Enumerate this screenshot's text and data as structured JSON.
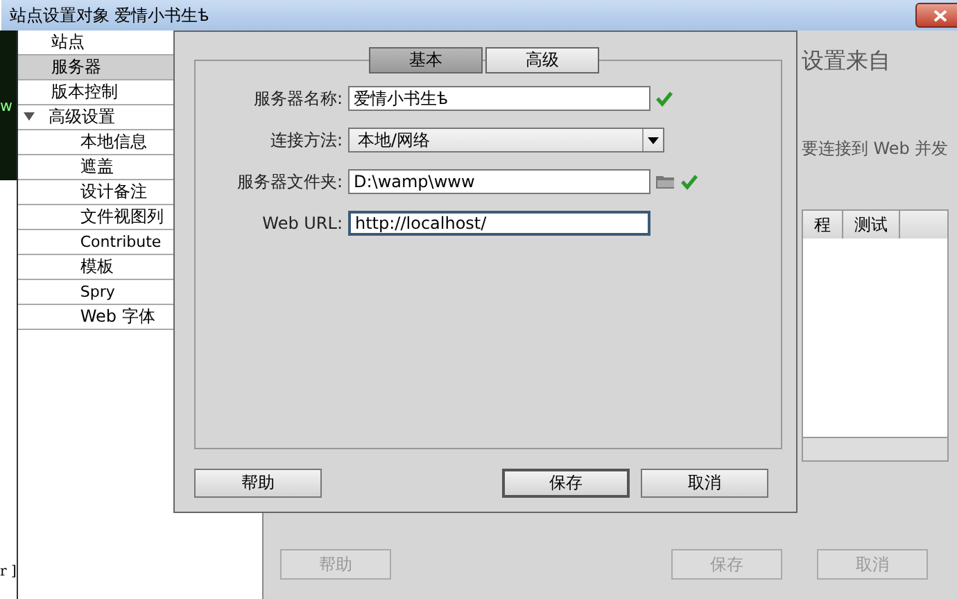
{
  "window": {
    "title": "站点设置对象 爱情小书生ѣ"
  },
  "background_app": {
    "top_text": "w",
    "bottom_text": "r ]"
  },
  "sidebar": {
    "items": [
      {
        "label": "站点",
        "selected": false
      },
      {
        "label": "服务器",
        "selected": true
      },
      {
        "label": "版本控制",
        "selected": false
      },
      {
        "label": "高级设置",
        "selected": false,
        "expanded": true,
        "children": [
          {
            "label": "本地信息",
            "selected": false
          },
          {
            "label": "遮盖",
            "selected": false
          },
          {
            "label": "设计备注",
            "selected": false
          },
          {
            "label": "文件视图列",
            "selected": false
          },
          {
            "label": "Contribute",
            "selected": false
          },
          {
            "label": "模板",
            "selected": false
          },
          {
            "label": "Spry",
            "selected": false
          },
          {
            "label": "Web 字体",
            "selected": false
          }
        ]
      }
    ]
  },
  "panel": {
    "heading": "设置来自",
    "description": "要连接到 Web 并发",
    "table": {
      "columns": [
        "程",
        "测试"
      ]
    },
    "buttons": [
      {
        "label": "帮助",
        "disabled": true
      },
      {
        "label": "保存",
        "disabled": true
      },
      {
        "label": "取消",
        "disabled": true
      }
    ]
  },
  "dialog": {
    "tabs": [
      {
        "label": "基本",
        "selected": true
      },
      {
        "label": "高级",
        "selected": false
      }
    ],
    "fields": [
      {
        "kind": "text",
        "label": "服务器名称:",
        "value": "爱情小书生ѣ",
        "valid": true
      },
      {
        "kind": "select",
        "label": "连接方法:",
        "value": "本地/网络"
      },
      {
        "kind": "folder",
        "label": "服务器文件夹:",
        "value": "D:\\wamp\\www",
        "valid": true
      },
      {
        "kind": "text",
        "label": "Web URL:",
        "value": "http://localhost/",
        "focused": true
      }
    ],
    "buttons": [
      {
        "label": "帮助",
        "default": false
      },
      {
        "label": "保存",
        "default": true
      },
      {
        "label": "取消",
        "default": false
      }
    ]
  }
}
